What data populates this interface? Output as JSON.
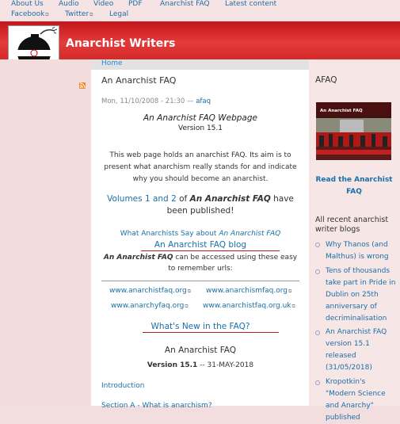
{
  "nav": {
    "row1": [
      "About Us",
      "Audio",
      "Video",
      "PDF",
      "Anarchist FAQ",
      "Latest content"
    ],
    "row2": [
      "Facebook",
      "Twitter",
      "Legal"
    ]
  },
  "site": {
    "title": "Anarchist Writers",
    "logo_caption": "Anarchist Writers"
  },
  "breadcrumb": "Home",
  "article": {
    "title": "An Anarchist FAQ",
    "meta_date": "Mon, 11/10/2008 - 21:30 —",
    "meta_author": "afaq",
    "page_heading": "An Anarchist FAQ Webpage",
    "version": "Version 15.1",
    "intro": "This web page holds an anarchist FAQ. Its aim is to present what anarchism really stands for and indicate why you should become an anarchist.",
    "volumes_link": "Volumes 1 and 2",
    "volumes_of": "of",
    "volumes_bold": "An Anarchist FAQ",
    "volumes_rest": "have been published!",
    "wasa_link_pre": "What Anarchists Say about",
    "wasa_link_em": "An Anarchist FAQ",
    "blog_link": "An Anarchist FAQ blog",
    "access_bold": "An Anarchist FAQ",
    "access_rest": "can be accessed using these easy to remember urls:",
    "urls": [
      "www.anarchistfaq.org",
      "www.anarchismfaq.org",
      "www.anarchyfaq.org",
      "www.anarchistfaq.org.uk"
    ],
    "whats_new": "What's New in the FAQ?",
    "faq_title": "An Anarchist FAQ",
    "faq_version": "Version 15.1",
    "faq_date": "-- 31-MAY-2018",
    "intro_link": "Introduction",
    "section_a": "Section A - What is anarchism?"
  },
  "sidebar": {
    "title": "AFAQ",
    "cover_title": "An Anarchist FAQ",
    "read_link": "Read the Anarchist FAQ",
    "recent_title": "All recent anarchist writer blogs",
    "blogs": [
      "Why Thanos (and Malthus) is wrong",
      "Tens of thousands take part in Pride in Dublin on 25th anniversary of decriminalisation",
      "An Anarchist FAQ version 15.1 released (31/05/2018)",
      "Kropotkin's \"Modern Science and Anarchy\" published"
    ]
  },
  "colors": {
    "header_red": "#c4161c",
    "link_blue": "#1a6fa8"
  }
}
